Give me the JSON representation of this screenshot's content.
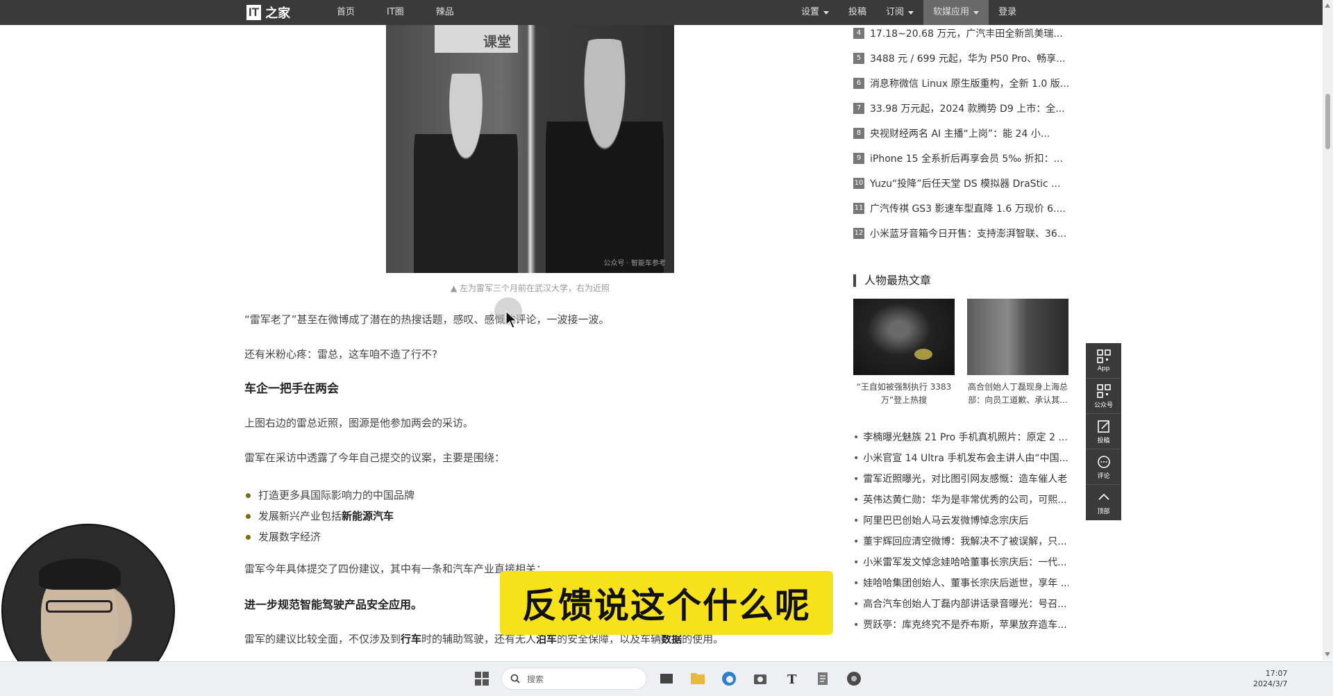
{
  "topnav": {
    "logo_it": "IT",
    "logo_zh": "之家",
    "left_items": [
      "首页",
      "IT圈",
      "辣品"
    ],
    "right_items": [
      {
        "label": "设置",
        "dropdown": true
      },
      {
        "label": "投稿",
        "dropdown": false
      },
      {
        "label": "订阅",
        "dropdown": true
      },
      {
        "label": "软媒应用",
        "dropdown": true,
        "active": true
      },
      {
        "label": "登录",
        "dropdown": false
      }
    ]
  },
  "article": {
    "photo_sign": "课堂",
    "photo_watermark": "公众号 · 智能车参考",
    "caption": "▲ 左为雷军三个月前在武汉大学，右为近照",
    "para1": "“雷军老了”甚至在微博成了潜在的热搜话题，感叹、感慨的评论，一波接一波。",
    "para2": "还有米粉心疼：雷总，这车咱不造了行不?",
    "heading1": "车企一把手在两会",
    "para3": "上图右边的雷总近照，图源是他参加两会的采访。",
    "para4": "雷军在采访中透露了今年自己提交的议案，主要是围绕：",
    "bullets": [
      {
        "pre": "打造更多具国际影响力的中国品牌",
        "bold": "",
        "post": ""
      },
      {
        "pre": "发展新兴产业包括",
        "bold": "新能源汽车",
        "post": ""
      },
      {
        "pre": "发展数字经济",
        "bold": "",
        "post": ""
      }
    ],
    "para5": "雷军今年具体提交了四份建议，其中有一条和汽车产业直接相关：",
    "heading2": "进一步规范智能驾驶产品安全应用。",
    "para6_a": "雷军的建议比较全面，不仅涉及到",
    "para6_b": "行车",
    "para6_c": "时的辅助驾驶，还有无人",
    "para6_d": "泊车",
    "para6_e": "的安全保障，以及车辆",
    "para6_f": "数据",
    "para6_g": "的使用。"
  },
  "sidebar": {
    "rank": [
      {
        "num": "4",
        "text": "17.18~20.68 万元，广汽丰田全新凯美瑞..."
      },
      {
        "num": "5",
        "text": "3488 元 / 699 元起，华为 P50 Pro、畅享..."
      },
      {
        "num": "6",
        "text": "消息称微信 Linux 原生版重构，全新 1.0 版..."
      },
      {
        "num": "7",
        "text": "33.98 万元起，2024 款腾势 D9 上市：全..."
      },
      {
        "num": "8",
        "text": "央视财经两名 AI 主播“上岗”：能 24 小..."
      },
      {
        "num": "9",
        "text": "iPhone 15 全系折后再享会员 5‰ 折扣：..."
      },
      {
        "num": "10",
        "text": "Yuzu“投降”后任天堂 DS 模拟器 DraStic ..."
      },
      {
        "num": "11",
        "text": "广汽传祺 GS3 影速车型直降 1.6 万现价 6...."
      },
      {
        "num": "12",
        "text": "小米蓝牙音箱今日开售：支持澎湃智联、36..."
      }
    ],
    "hot_title": "人物最热文章",
    "hot_cards": [
      {
        "caption_l1": "“王自如被强制执行 3383",
        "caption_l2": "万”登上热搜"
      },
      {
        "caption_l1": "高合创始人丁磊现身上海总",
        "caption_l2": "部：向员工道歉、承认其..."
      }
    ],
    "news": [
      "李楠曝光魅族 21 Pro 手机真机照片：原定 2 ...",
      "小米官宣 14 Ultra 手机发布会主讲人由“中国...",
      "雷军近照曝光，对比图引网友感慨：造车催人老",
      "英伟达黄仁勋：华为是非常优秀的公司，可熙...",
      "阿里巴巴创始人马云发微博悼念宗庆后",
      "董宇辉回应清空微博：我解决不了被误解，只...",
      "小米雷军发文悼念娃哈哈董事长宗庆后：一代...",
      "娃哈哈集团创始人、董事长宗庆后逝世，享年 ...",
      "高合汽车创始人丁磊内部讲话录音曝光：号召...",
      "贾跃亭：库克终究不是乔布斯，苹果放弃造车..."
    ]
  },
  "toolbar": [
    "App",
    "公众号",
    "投稿",
    "评论",
    "顶部"
  ],
  "subtitle": "反馈说这个什么呢",
  "taskbar": {
    "search_placeholder": "搜索",
    "time": "17:07",
    "date": "2024/3/7"
  }
}
